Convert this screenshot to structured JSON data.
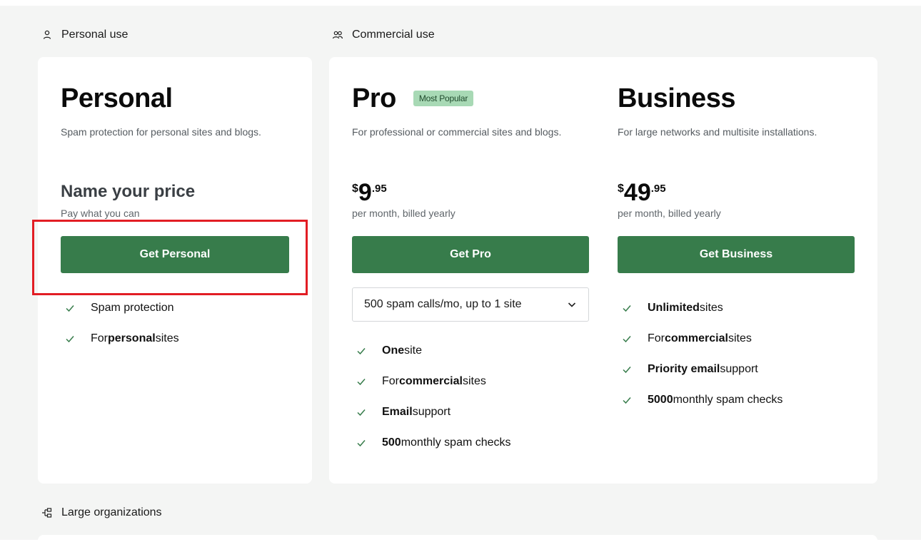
{
  "sections": {
    "personal": {
      "label": "Personal use",
      "icon": "person-icon"
    },
    "commercial": {
      "label": "Commercial use",
      "icon": "people-icon"
    },
    "large": {
      "label": "Large organizations",
      "icon": "org-chart-icon"
    }
  },
  "plans": {
    "personal": {
      "name": "Personal",
      "description": "Spam protection for personal sites and blogs.",
      "price_heading": "Name your price",
      "price_note": "Pay what you can",
      "cta": "Get Personal",
      "features": [
        {
          "pre": "",
          "bold": "",
          "post": "Spam protection"
        },
        {
          "pre": "For ",
          "bold": "personal",
          "post": " sites"
        }
      ]
    },
    "pro": {
      "name": "Pro",
      "badge": "Most Popular",
      "description": "For professional or commercial sites and blogs.",
      "price": {
        "currency": "$",
        "main": "9",
        "cents": ".95"
      },
      "billing": "per month, billed yearly",
      "cta": "Get Pro",
      "selected_option": "500 spam calls/mo, up to 1 site",
      "features": [
        {
          "pre": "",
          "bold": "One",
          "post": " site"
        },
        {
          "pre": "For ",
          "bold": "commercial",
          "post": " sites"
        },
        {
          "pre": "",
          "bold": "Email",
          "post": " support"
        },
        {
          "pre": "",
          "bold": "500",
          "post": " monthly spam checks"
        }
      ]
    },
    "business": {
      "name": "Business",
      "description": "For large networks and multisite installations.",
      "price": {
        "currency": "$",
        "main": "49",
        "cents": ".95"
      },
      "billing": "per month, billed yearly",
      "cta": "Get Business",
      "features": [
        {
          "pre": "",
          "bold": "Unlimited",
          "post": " sites"
        },
        {
          "pre": "For ",
          "bold": "commercial",
          "post": " sites"
        },
        {
          "pre": "",
          "bold": "Priority email",
          "post": " support"
        },
        {
          "pre": "",
          "bold": "5000",
          "post": " monthly spam checks"
        }
      ]
    }
  },
  "colors": {
    "button": "#377c4b",
    "badge_bg": "#a8d9b5",
    "highlight": "#e21d24",
    "check": "#377c4b",
    "page_bg": "#f4f5f4"
  }
}
